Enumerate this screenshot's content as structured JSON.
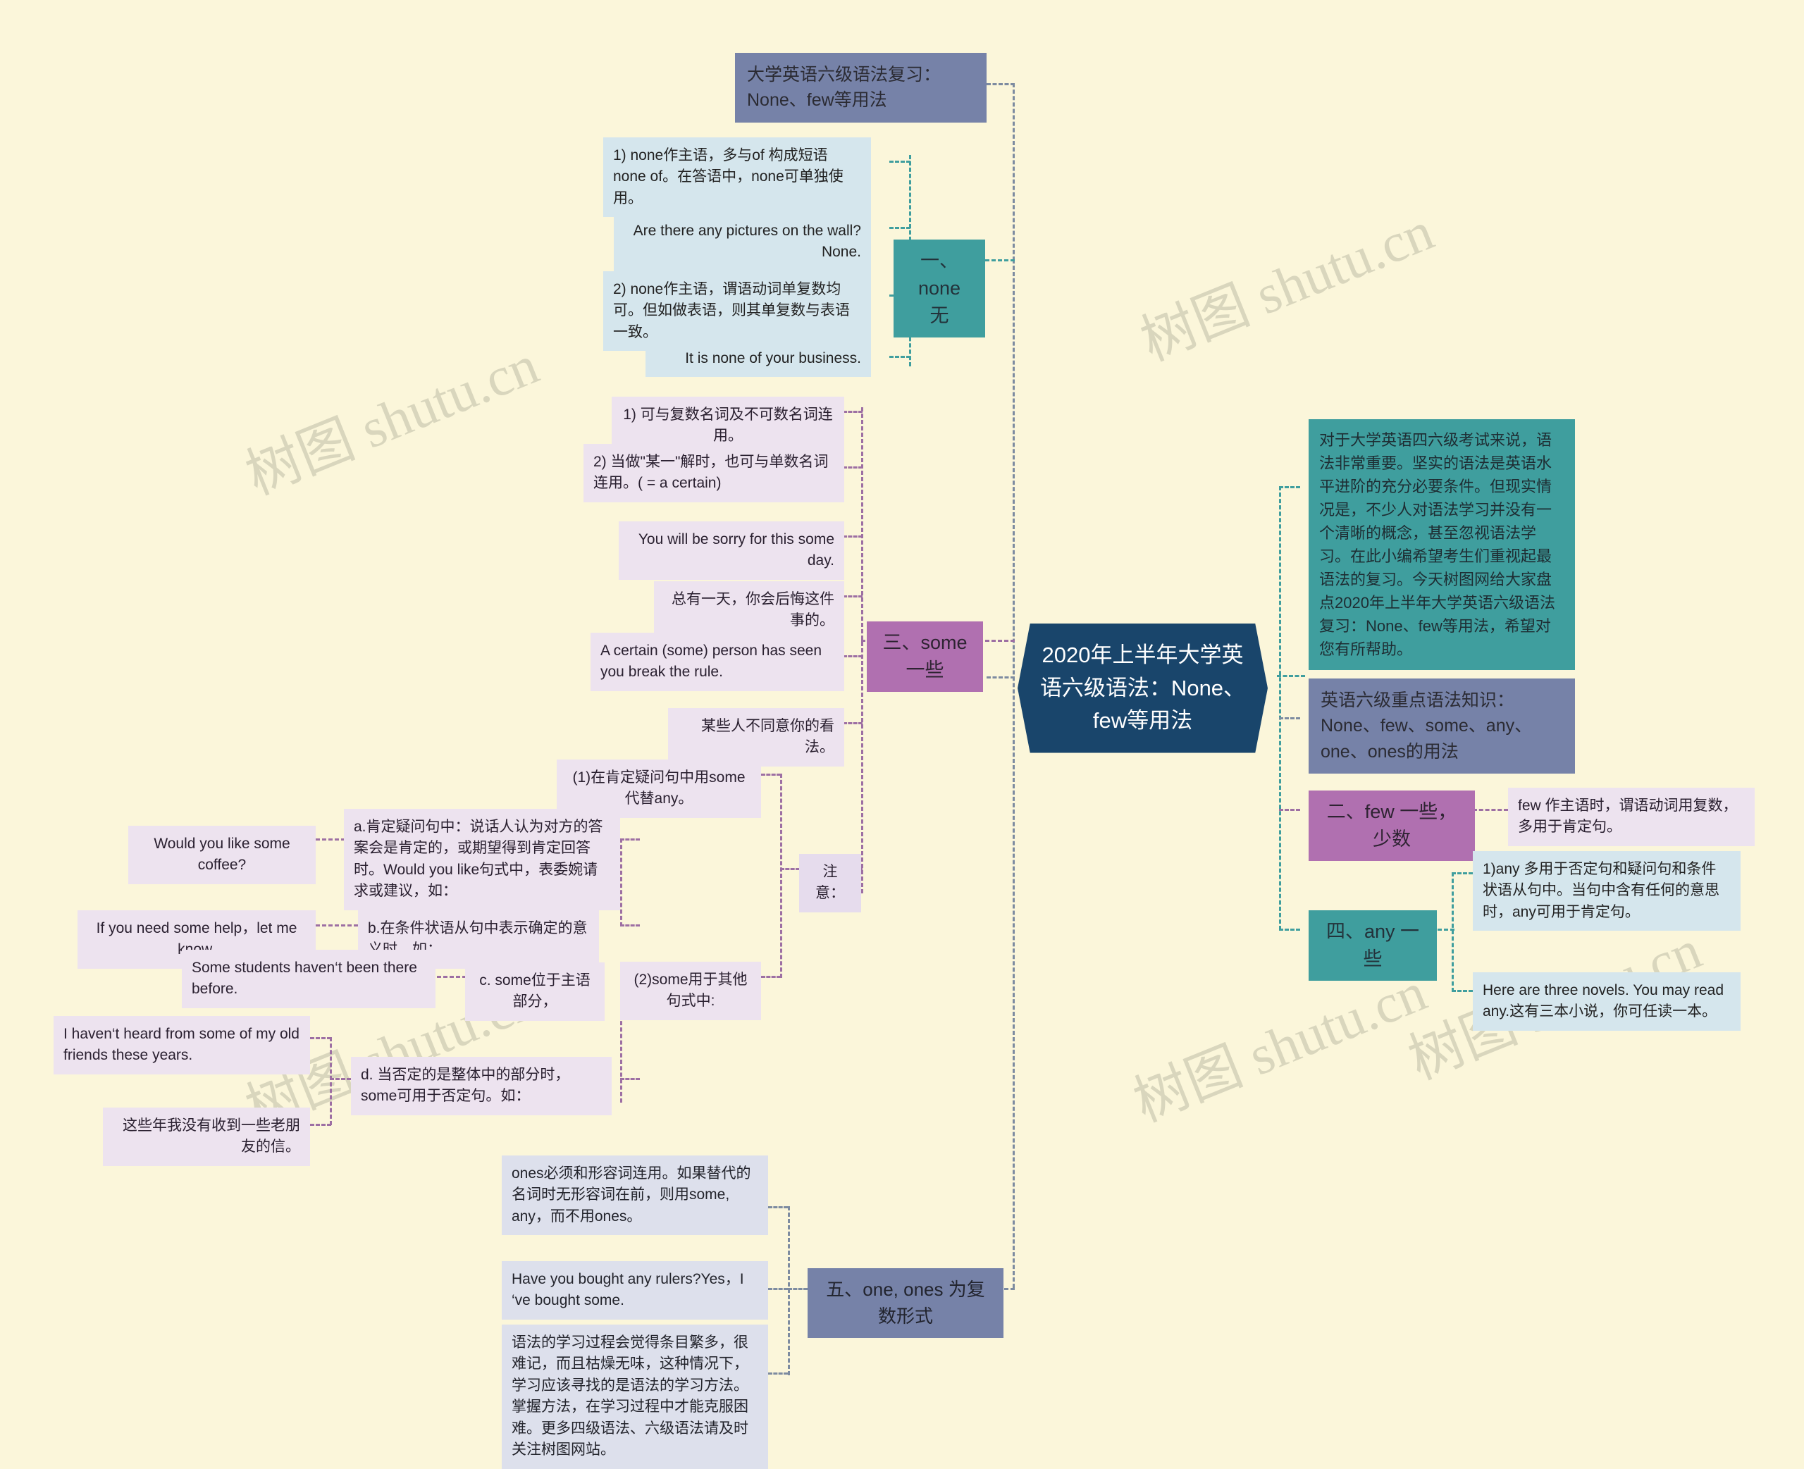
{
  "meta": {
    "background_color": "#fbf6da",
    "root_color": "#19456b",
    "teal": "#3f9e9e",
    "purple": "#b070b0",
    "slate": "#7682a8",
    "leaf_blue": "#d5e6ed",
    "leaf_lilac": "#ede3ef",
    "leaf_steel": "#dde0ec"
  },
  "watermarks": [
    "树图 shutu.cn",
    "树图 shutu.cn",
    "树图 shutu.cn",
    "树图 shutu.cn",
    "树图 shutu.cn"
  ],
  "root": {
    "title": "2020年上半年大学英语六级语法：None、few等用法"
  },
  "left": {
    "title_bar": "大学英语六级语法复习：None、few等用法",
    "none": {
      "label": "一、 none 无",
      "items": [
        "1) none作主语，多与of 构成短语 none of。在答语中，none可单独使用。",
        "Are there any pictures on the wall?None.",
        "2) none作主语，谓语动词单复数均可。但如做表语，则其单复数与表语一致。",
        "It is none of your business."
      ]
    },
    "some": {
      "label": "三、some 一些",
      "items": [
        "1) 可与复数名词及不可数名词连用。",
        "2) 当做\"某一\"解时，也可与单数名词连用。( = a certain)",
        "You will be sorry for this some day.",
        "总有一天，你会后悔这件事的。",
        "A certain (some) person has seen you break the rule.",
        "某些人不同意你的看法。"
      ],
      "note": {
        "label": "注意：",
        "sub1": "(1)在肯定疑问句中用some代替any。",
        "sub2": "(2)some用于其他句式中:",
        "rules": [
          {
            "text": "a.肯定疑问句中：说话人认为对方的答案会是肯定的，或期望得到肯定回答时。Would you like句式中，表委婉请求或建议，如：",
            "example": "Would you like some coffee?"
          },
          {
            "text": "b.在条件状语从句中表示确定的意义时，如：",
            "example": "If you need some help，let me know."
          },
          {
            "text": "c. some位于主语部分，",
            "example": "Some students haven‘t been there before."
          },
          {
            "text": "d. 当否定的是整体中的部分时，some可用于否定句。如：",
            "example": "I haven‘t heard from some of my old friends these years.",
            "example_cn": "这些年我没有收到一些老朋友的信。"
          }
        ]
      }
    },
    "ones": {
      "label": "五、one, ones 为复数形式",
      "items": [
        "ones必须和形容词连用。如果替代的名词时无形容词在前，则用some, any，而不用ones。",
        "Have you bought any rulers?Yes，I ‘ve bought some.",
        "语法的学习过程会觉得条目繁多，很难记，而且枯燥无味，这种情况下，学习应该寻找的是语法的学习方法。掌握方法，在学习过程中才能克服困难。更多四级语法、六级语法请及时关注树图网站。"
      ]
    }
  },
  "right": {
    "intro": "对于大学英语四六级考试来说，语法非常重要。坚实的语法是英语水平进阶的充分必要条件。但现实情况是，不少人对语法学习并没有一个清晰的概念，甚至忽视语法学习。在此小编希望考生们重视起最语法的复习。今天树图网给大家盘点2020年上半年大学英语六级语法复习：None、few等用法，希望对您有所帮助。",
    "knowledge_bar": "英语六级重点语法知识：None、few、some、any、one、ones的用法",
    "few": {
      "label": "二、few 一些，少数",
      "item": "few 作主语时，谓语动词用复数，多用于肯定句。"
    },
    "any": {
      "label": "四、any 一些",
      "items": [
        "1)any 多用于否定句和疑问句和条件状语从句中。当句中含有任何的意思时，any可用于肯定句。",
        "Here are three novels. You may read any.这有三本小说，你可任读一本。"
      ]
    }
  }
}
